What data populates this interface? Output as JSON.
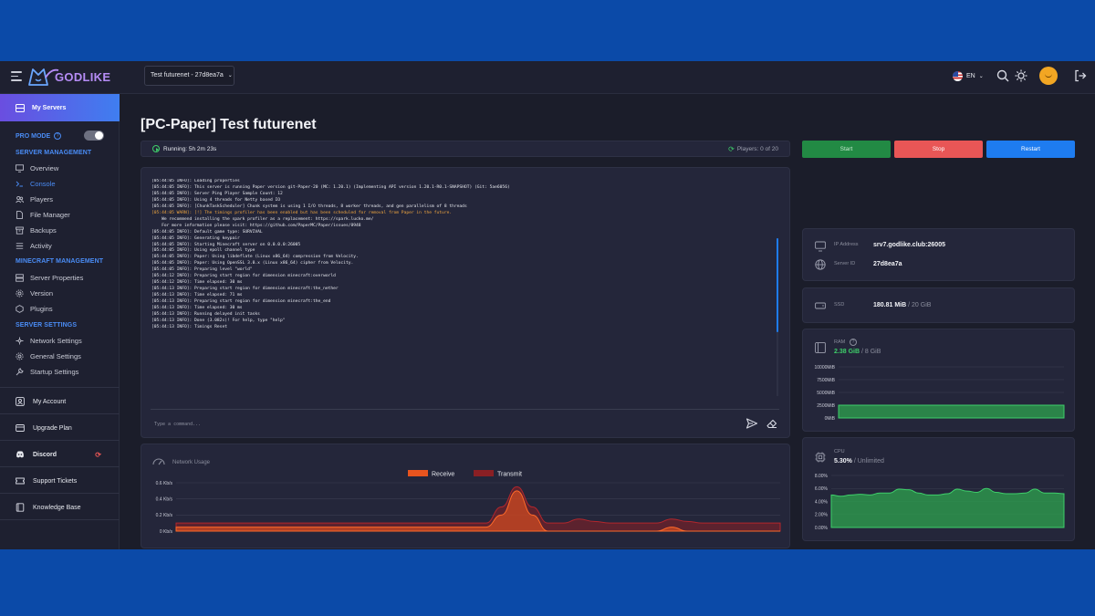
{
  "header": {
    "logo_text": "GODLIKE",
    "server_select": "Test futurenet - 27d8ea7a",
    "language": "EN"
  },
  "sidebar": {
    "my_servers": "My Servers",
    "pro_mode": "PRO MODE",
    "server_management": {
      "title": "SERVER MANAGEMENT",
      "items": [
        "Overview",
        "Console",
        "Players",
        "File Manager",
        "Backups",
        "Activity"
      ]
    },
    "minecraft_management": {
      "title": "MINECRAFT MANAGEMENT",
      "items": [
        "Server Properties",
        "Version",
        "Plugins"
      ]
    },
    "server_settings": {
      "title": "SERVER SETTINGS",
      "items": [
        "Network Settings",
        "General Settings",
        "Startup Settings"
      ]
    },
    "links": [
      "My Account",
      "Upgrade Plan",
      "Discord",
      "Support Tickets",
      "Knowledge Base"
    ]
  },
  "page": {
    "title": "[PC-Paper] Test futurenet",
    "status_prefix": "Running:",
    "uptime": "5h 2m 23s",
    "players": "Players: 0 of 20"
  },
  "actions": {
    "start": "Start",
    "stop": "Stop",
    "restart": "Restart"
  },
  "console": {
    "lines": [
      {
        "text": "[05:44:05 INFO]: Loading properties",
        "warn": false
      },
      {
        "text": "[05:44:05 INFO]: This server is running Paper version git-Paper-20 (MC: 1.20.1) (Implementing API version 1.20.1-R0.1-SNAPSHOT) (Git: 5ae6056)",
        "warn": false
      },
      {
        "text": "[05:44:05 INFO]: Server Ping Player Sample Count: 12",
        "warn": false
      },
      {
        "text": "[05:44:05 INFO]: Using 4 threads for Netty based IO",
        "warn": false
      },
      {
        "text": "[05:44:05 INFO]: [ChunkTaskScheduler] Chunk system is using 1 I/O threads, 8 worker threads, and gen parallelism of 8 threads",
        "warn": false
      },
      {
        "text": "[05:44:05 WARN]: [!] The timings profiler has been enabled but has been scheduled for removal from Paper in the future.",
        "warn": true
      },
      {
        "text": "    We recommend installing the spark profiler as a replacement: https://spark.lucko.me/",
        "warn": false
      },
      {
        "text": "    For more information please visit: https://github.com/PaperMC/Paper/issues/8948",
        "warn": false
      },
      {
        "text": "[05:44:05 INFO]: Default game type: SURVIVAL",
        "warn": false
      },
      {
        "text": "[05:44:05 INFO]: Generating keypair",
        "warn": false
      },
      {
        "text": "[05:44:05 INFO]: Starting Minecraft server on 0.0.0.0:26005",
        "warn": false
      },
      {
        "text": "[05:44:05 INFO]: Using epoll channel type",
        "warn": false
      },
      {
        "text": "[05:44:05 INFO]: Paper: Using libdeflate (Linux x86_64) compression from Velocity.",
        "warn": false
      },
      {
        "text": "[05:44:05 INFO]: Paper: Using OpenSSL 3.0.x (Linux x86_64) cipher from Velocity.",
        "warn": false
      },
      {
        "text": "[05:44:05 INFO]: Preparing level \"world\"",
        "warn": false
      },
      {
        "text": "[05:44:12 INFO]: Preparing start region for dimension minecraft:overworld",
        "warn": false
      },
      {
        "text": "[05:44:12 INFO]: Time elapsed: 30 ms",
        "warn": false
      },
      {
        "text": "[05:44:13 INFO]: Preparing start region for dimension minecraft:the_nether",
        "warn": false
      },
      {
        "text": "[05:44:13 INFO]: Time elapsed: 71 ms",
        "warn": false
      },
      {
        "text": "[05:44:13 INFO]: Preparing start region for dimension minecraft:the_end",
        "warn": false
      },
      {
        "text": "[05:44:13 INFO]: Time elapsed: 30 ms",
        "warn": false
      },
      {
        "text": "[05:44:13 INFO]: Running delayed init tasks",
        "warn": false
      },
      {
        "text": "[05:44:13 INFO]: Done (3.082s)! For help, type \"help\"",
        "warn": false
      },
      {
        "text": "[05:44:13 INFO]: Timings Reset",
        "warn": false
      }
    ],
    "placeholder": "Type a command..."
  },
  "info": {
    "ip_label": "IP Address",
    "ip_value": "srv7.godlike.club:26005",
    "id_label": "Server ID",
    "id_value": "27d8ea7a",
    "ssd_label": "SSD",
    "ssd_used": "180.81 MiB",
    "ssd_total": "/ 20 GiB",
    "ram_label": "RAM",
    "ram_used": "2.38 GiB",
    "ram_total": "/ 8 GiB",
    "cpu_label": "CPU",
    "cpu_used": "5.30%",
    "cpu_total": "/ Unlimited"
  },
  "network_chart": {
    "title": "Network Usage",
    "legend": [
      "Receive",
      "Transmit"
    ],
    "y_ticks": [
      "0.6 Kb/s",
      "0.4 Kb/s",
      "0.2 Kb/s",
      "0 Kb/s"
    ],
    "colors": {
      "receive": "#e8541e",
      "transmit": "#8a1f24"
    }
  },
  "chart_data": [
    {
      "type": "area",
      "title": "Network Usage",
      "series": [
        {
          "name": "Receive",
          "values": [
            0.05,
            0.05,
            0.05,
            0.05,
            0.05,
            0.05,
            0.05,
            0.05,
            0.05,
            0.05,
            0.05,
            0.05,
            0.05,
            0.05,
            0.05,
            0.05,
            0.05,
            0.05,
            0.05,
            0.05,
            0.05,
            0.2,
            0.5,
            0.2,
            0.0,
            0.0,
            0.0,
            0.0,
            0.0,
            0.0,
            0.0,
            0.0,
            0.05,
            0.0,
            0.0,
            0.0,
            0.0,
            0.0,
            0.0,
            0.0
          ]
        },
        {
          "name": "Transmit",
          "values": [
            0.1,
            0.1,
            0.1,
            0.1,
            0.1,
            0.1,
            0.1,
            0.1,
            0.1,
            0.1,
            0.1,
            0.1,
            0.1,
            0.1,
            0.1,
            0.1,
            0.1,
            0.1,
            0.1,
            0.1,
            0.1,
            0.3,
            0.55,
            0.3,
            0.1,
            0.1,
            0.15,
            0.12,
            0.1,
            0.1,
            0.1,
            0.1,
            0.15,
            0.12,
            0.1,
            0.1,
            0.1,
            0.1,
            0.1,
            0.1
          ]
        }
      ],
      "y_ticks": [
        "0.6 Kb/s",
        "0.4 Kb/s",
        "0.2 Kb/s",
        "0 Kb/s"
      ],
      "ylim": [
        0,
        0.6
      ],
      "legend": "top-center"
    },
    {
      "type": "area",
      "title": "",
      "series": [
        {
          "name": "",
          "values": [
            2500,
            2500,
            2500,
            2500,
            2500,
            2500,
            2500,
            2500,
            2500,
            2500
          ]
        }
      ],
      "y_ticks": [
        "10000MiB",
        "7500MiB",
        "5000MiB",
        "2500MiB",
        "0MiB"
      ],
      "ylim": [
        0,
        10000
      ],
      "color": "#2ea44f"
    },
    {
      "type": "area",
      "title": "",
      "series": [
        {
          "name": "",
          "values": [
            5.0,
            4.8,
            5.0,
            5.1,
            5.0,
            5.3,
            5.3,
            5.9,
            5.8,
            5.3,
            5.0,
            5.0,
            5.2,
            5.9,
            5.6,
            5.4,
            6.0,
            5.4,
            5.2,
            5.2,
            5.3,
            5.9,
            5.3,
            5.3,
            5.2
          ]
        }
      ],
      "y_ticks": [
        "8.00%",
        "6.00%",
        "4.00%",
        "2.00%",
        "0.00%"
      ],
      "ylim": [
        0,
        8
      ],
      "color": "#2ea44f"
    }
  ]
}
